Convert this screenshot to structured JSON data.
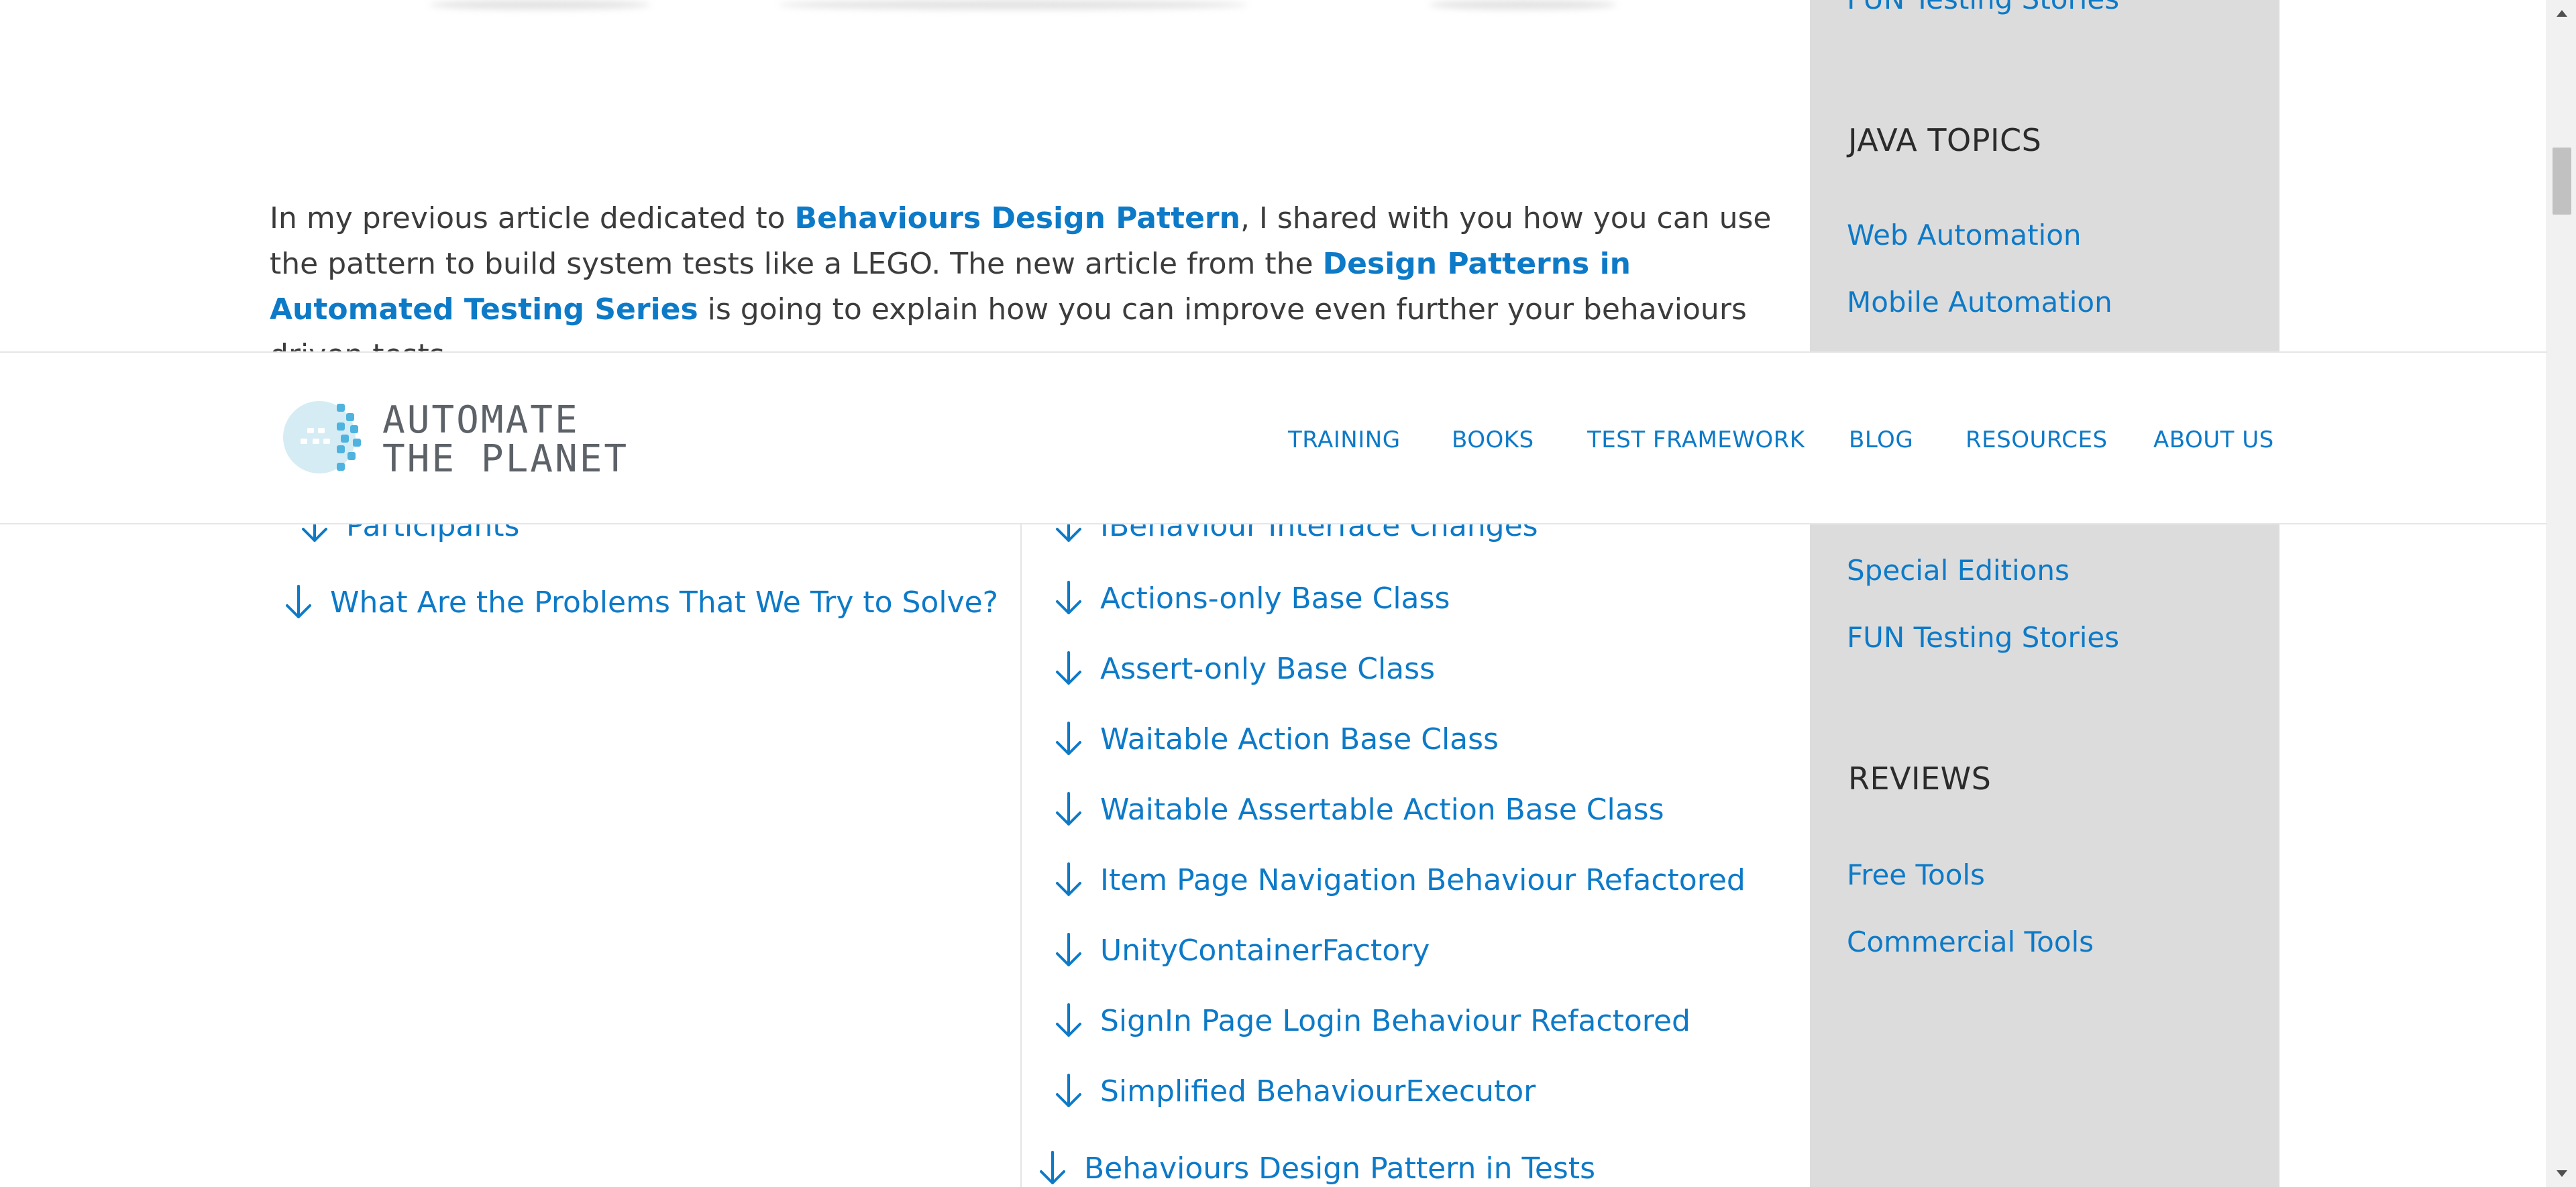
{
  "intro": {
    "text_1": "In my previous article dedicated to ",
    "link_1": "Behaviours Design Pattern",
    "text_2": ", I shared with you how you can use the pattern to build system tests like a LEGO. The new article from the ",
    "link_2": "Design Patterns in Automated Testing Series",
    "text_3": " is going to explain how you can improve even further your behaviours driven tests."
  },
  "sidebar": {
    "top_link": "FUN Testing Stories",
    "java_heading": "JAVA TOPICS",
    "java_links": [
      "Web Automation",
      "Mobile Automation"
    ],
    "more_links": [
      "Special Editions",
      "FUN Testing Stories"
    ],
    "reviews_heading": "REVIEWS",
    "reviews_links": [
      "Free Tools",
      "Commercial Tools"
    ]
  },
  "header": {
    "logo_line_1": "AUTOMATE",
    "logo_line_2": "THE PLANET",
    "nav": [
      "TRAINING",
      "BOOKS",
      "TEST FRAMEWORK",
      "BLOG",
      "RESOURCES",
      "ABOUT US"
    ]
  },
  "toc_left": [
    "Participants",
    "What Are the Problems That We Try to Solve?"
  ],
  "toc_right": [
    "IBehaviour Interface Changes",
    "Actions-only Base Class",
    "Assert-only Base Class",
    "Waitable Action Base Class",
    "Waitable Assertable Action Base Class",
    "Item Page Navigation Behaviour Refactored",
    "UnityContainerFactory",
    "SignIn Page Login Behaviour Refactored",
    "Simplified BehaviourExecutor",
    "Behaviours Design Pattern in Tests"
  ],
  "colors": {
    "link": "#0d7ac8",
    "sidebar_bg": "#dcdcdc",
    "text": "#3c3c3c"
  }
}
